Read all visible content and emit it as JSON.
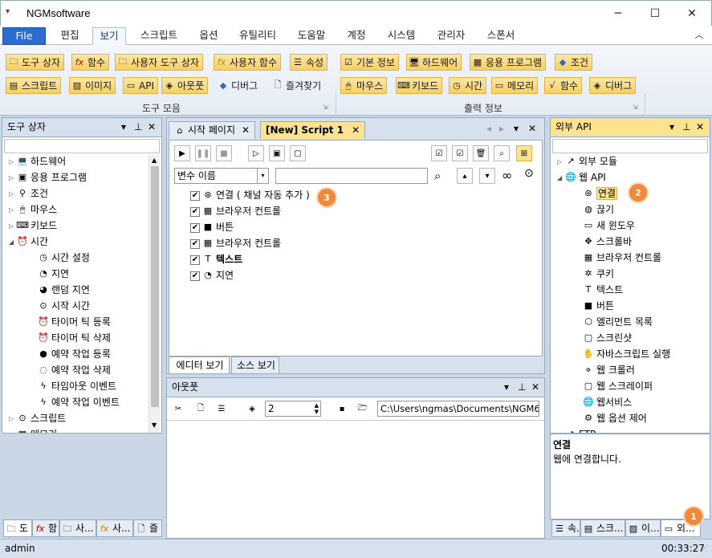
{
  "window": {
    "title": "NGMsoftware",
    "menu_glyph": "▾",
    "min": "─",
    "max": "☐",
    "close": "✕"
  },
  "ribbon_tabs": [
    "File",
    "편집",
    "보기",
    "스크립트",
    "옵션",
    "유틸리티",
    "도움말",
    "계정",
    "시스템",
    "관리자",
    "스폰서"
  ],
  "collapse_glyph": "︿",
  "toolbox_group": {
    "label": "도구 모음",
    "row1": [
      "도구 상자",
      "함수",
      "사용자 도구 상자",
      "사용자 함수",
      "속성"
    ],
    "row2": [
      "스크립트",
      "이미지",
      "API",
      "아웃풋",
      "디버그",
      "즐겨찾기"
    ]
  },
  "output_group": {
    "label": "출력 정보",
    "row1": [
      "기본 정보",
      "하드웨어",
      "응용 프로그램",
      "조건"
    ],
    "row2": [
      "마우스",
      "키보드",
      "시간",
      "메모리",
      "함수",
      "디버그"
    ]
  },
  "left_panel": {
    "title": "도구 상자",
    "items": [
      {
        "label": "하드웨어",
        "exp": "▷",
        "icon": "💻"
      },
      {
        "label": "응용 프로그램",
        "exp": "▷",
        "icon": "▣"
      },
      {
        "label": "조건",
        "exp": "▷",
        "icon": "⚲"
      },
      {
        "label": "마우스",
        "exp": "▷",
        "icon": "🖱"
      },
      {
        "label": "키보드",
        "exp": "▷",
        "icon": "⌨"
      },
      {
        "label": "시간",
        "exp": "◢",
        "icon": "⏰"
      }
    ],
    "time_children": [
      "시간 설정",
      "지연",
      "랜덤 지연",
      "시작 시간",
      "타이머 틱 등록",
      "타이머 틱 삭제",
      "예약 작업 등록",
      "예약 작업 삭제",
      "타임아웃 이벤트",
      "예약 작업 이벤트"
    ],
    "time_icons": [
      "◷",
      "◔",
      "◕",
      "⊙",
      "⏰",
      "⏰",
      "●",
      "◌",
      "ϟ",
      "ϟ"
    ],
    "tail": [
      {
        "label": "스크립트",
        "icon": "⊙"
      },
      {
        "label": "메모리",
        "icon": "▦"
      }
    ],
    "bottom_tabs": [
      "도",
      "함",
      "사...",
      "사...",
      "즐"
    ]
  },
  "editor": {
    "tabs": [
      "시작 페이지",
      "[New] Script 1"
    ],
    "variable_select": "변수 이름",
    "search_value": "",
    "lines": [
      {
        "text": "연결 ( 채널 자동 추가 )",
        "icon": "⊛"
      },
      {
        "text": "브라우저 컨트롤",
        "icon": "▦"
      },
      {
        "text": "버튼",
        "icon": "■"
      },
      {
        "text": "브라우저 컨트롤",
        "icon": "▦"
      },
      {
        "text": "텍스트",
        "icon": "T"
      },
      {
        "text": "지연",
        "icon": "◔"
      }
    ],
    "bottom_tabs": [
      "에디터 보기",
      "소스 보기"
    ]
  },
  "output_panel": {
    "title": "아웃풋",
    "spinner": "2",
    "path": "C:\\Users\\ngmas\\Documents\\NGM6\\"
  },
  "right_panel": {
    "title": "외부 API",
    "top": [
      {
        "label": "외부 모듈",
        "exp": "▷",
        "icon": "↗"
      },
      {
        "label": "웹 API",
        "exp": "◢",
        "icon": "🌐"
      }
    ],
    "children": [
      "연결",
      "끊기",
      "새 윈도우",
      "스크롤바",
      "브라우저 컨트롤",
      "쿠키",
      "텍스트",
      "버튼",
      "엘리먼트 목록",
      "스크린샷",
      "자바스크립트 실행",
      "웹 크롤러",
      "웹 스크레이퍼",
      "웹서비스",
      "웹 옵션 제어"
    ],
    "child_icons": [
      "⊛",
      "◍",
      "▭",
      "✥",
      "▦",
      "✲",
      "T",
      "■",
      "⬡",
      "▢",
      "✋",
      "⋄",
      "▢",
      "🌐",
      "⚙"
    ],
    "tail": "FTP",
    "desc_title": "연결",
    "desc_text": "웹에 연결합니다.",
    "bottom_tabs": [
      "속...",
      "스크...",
      "이...",
      "외..."
    ]
  },
  "badges": [
    "1",
    "2",
    "3"
  ],
  "status": {
    "user": "admin",
    "time": "00:33:27"
  }
}
